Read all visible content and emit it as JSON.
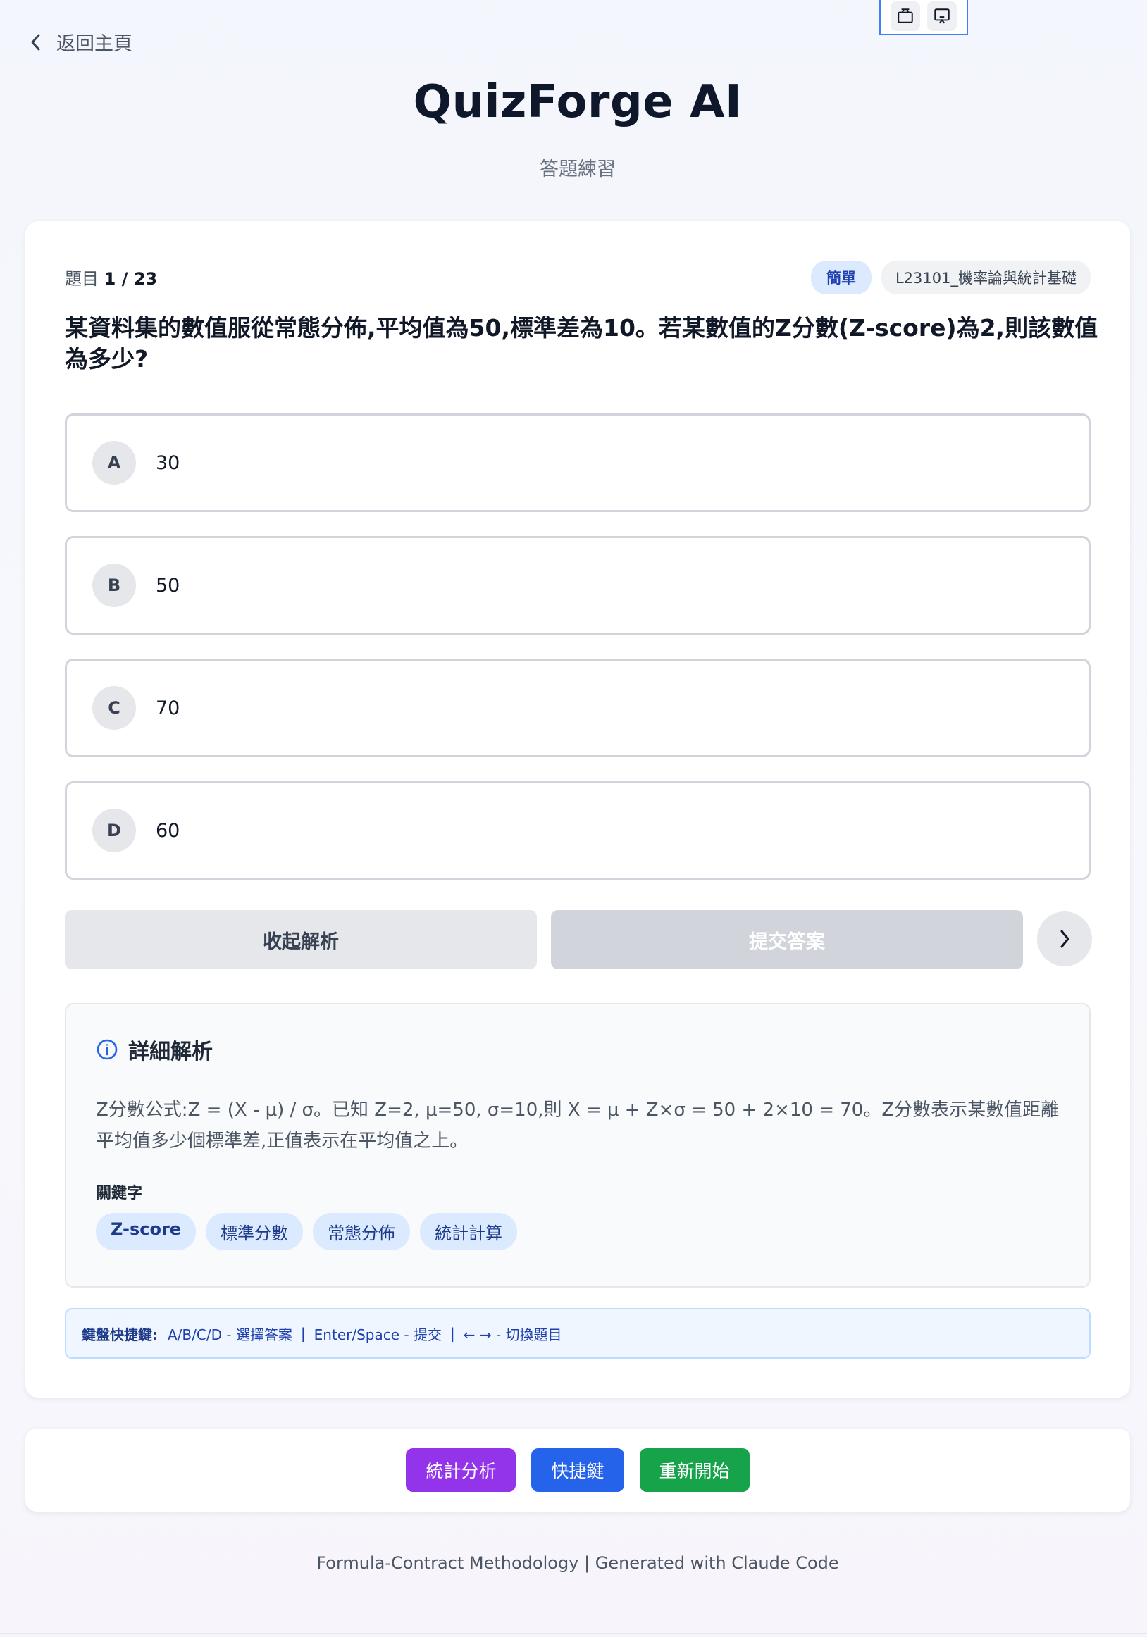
{
  "nav": {
    "back_label": "返回主頁"
  },
  "header": {
    "title": "QuizForge AI",
    "subtitle": "答題練習"
  },
  "quiz": {
    "counter_prefix": "題目",
    "counter_value": "1 / 23",
    "difficulty": "簡單",
    "topic": "L23101_機率論與統計基礎",
    "question": "某資料集的數值服從常態分佈,平均值為50,標準差為10。若某數值的Z分數(Z-score)為2,則該數值為多少?",
    "options": [
      {
        "letter": "A",
        "value": "30"
      },
      {
        "letter": "B",
        "value": "50"
      },
      {
        "letter": "C",
        "value": "70"
      },
      {
        "letter": "D",
        "value": "60"
      }
    ],
    "collapse_label": "收起解析",
    "submit_label": "提交答案"
  },
  "explanation": {
    "title": "詳細解析",
    "text": "Z分數公式:Z = (X - μ) / σ。已知 Z=2, μ=50, σ=10,則 X = μ + Z×σ = 50 + 2×10 = 70。Z分數表示某數值距離平均值多少個標準差,正值表示在平均值之上。",
    "keywords_label": "關鍵字",
    "keywords": [
      "Z-score",
      "標準分數",
      "常態分佈",
      "統計計算"
    ]
  },
  "shortcuts": {
    "label": "鍵盤快捷鍵:",
    "items": [
      "A/B/C/D - 選擇答案",
      "Enter/Space - 提交",
      "← → - 切換題目"
    ],
    "separator": "|"
  },
  "actions": {
    "stats_label": "統計分析",
    "shortcuts_label": "快捷鍵",
    "restart_label": "重新開始"
  },
  "footer": {
    "text": "Formula-Contract Methodology | Generated with Claude Code"
  },
  "colors": {
    "stats": "#9333ea",
    "shortcuts": "#2563eb",
    "restart": "#16a34a",
    "accent": "#1e40af"
  },
  "icons": {
    "back": "chevron-left-icon",
    "next": "chevron-right-icon",
    "info": "info-circle-icon",
    "toolbar_1": "camera-icon",
    "toolbar_2": "screen-cast-icon"
  }
}
